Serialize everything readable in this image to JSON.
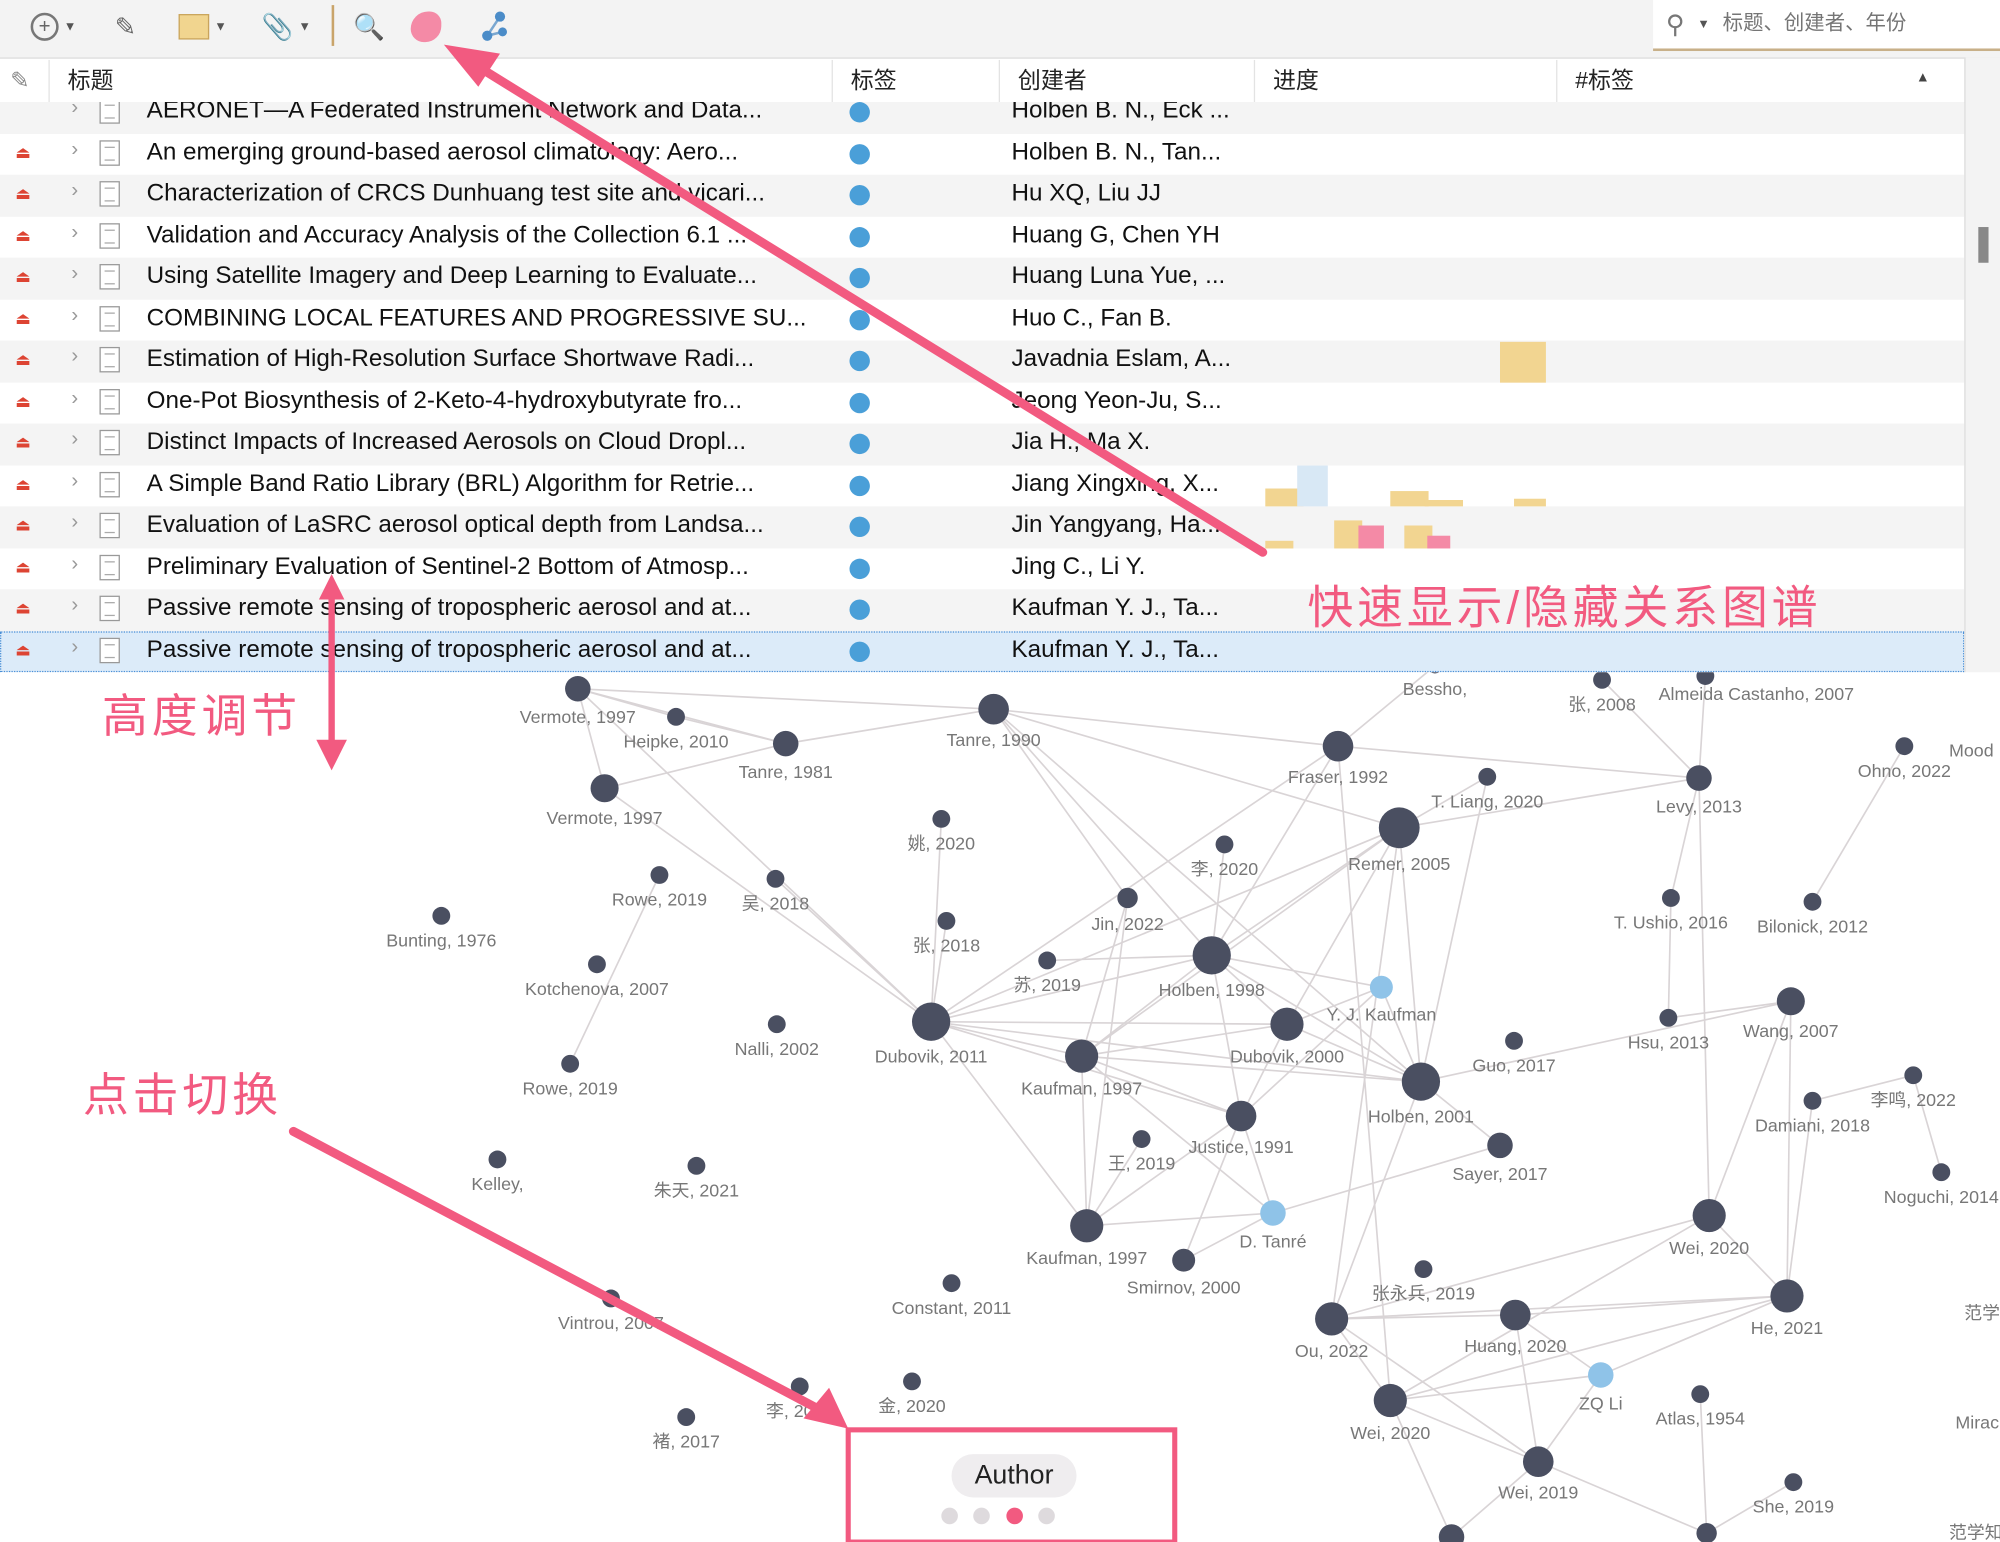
{
  "toolbar": {
    "buttons": [
      "new-item",
      "magic-wand",
      "new-collection",
      "attachment",
      "advanced-search",
      "toggle-graph",
      "graph-view"
    ],
    "search_placeholder": "标题、创建者、年份"
  },
  "table": {
    "columns": {
      "title": "标题",
      "tags": "标签",
      "creator": "创建者",
      "progress": "进度",
      "hashtags": "#标签"
    },
    "tag_color": "#4a9fd8",
    "rows": [
      {
        "title": "AERONET—A Federated Instrument Network and Data...",
        "creator": "Holben B. N., Eck ..."
      },
      {
        "title": "An emerging ground-based aerosol climatology: Aero...",
        "creator": "Holben B. N., Tan..."
      },
      {
        "title": "Characterization of CRCS Dunhuang test site and vicari...",
        "creator": "Hu XQ, Liu JJ"
      },
      {
        "title": "Validation and Accuracy Analysis of the Collection 6.1 ...",
        "creator": "Huang G, Chen YH"
      },
      {
        "title": "Using Satellite Imagery and Deep Learning to Evaluate...",
        "creator": "Huang Luna Yue, ..."
      },
      {
        "title": "COMBINING LOCAL FEATURES AND PROGRESSIVE SU...",
        "creator": "Huo C., Fan B."
      },
      {
        "title": "Estimation of High-Resolution Surface Shortwave Radi...",
        "creator": "Javadnia Eslam, A..."
      },
      {
        "title": "One-Pot Biosynthesis of 2-Keto-4-hydroxybutyrate fro...",
        "creator": "Jeong Yeon-Ju, S..."
      },
      {
        "title": "Distinct Impacts of Increased Aerosols on Cloud Dropl...",
        "creator": "Jia H., Ma X."
      },
      {
        "title": "A Simple Band Ratio Library (BRL) Algorithm for Retrie...",
        "creator": "Jiang Xingxing, X..."
      },
      {
        "title": "Evaluation of LaSRC aerosol optical depth from Landsa...",
        "creator": "Jin Yangyang, Ha..."
      },
      {
        "title": "Preliminary Evaluation of Sentinel-2 Bottom of Atmosp...",
        "creator": "Jing C., Li Y."
      },
      {
        "title": "Passive remote sensing of tropospheric aerosol and at...",
        "creator": "Kaufman Y. J., Ta..."
      },
      {
        "title": "Passive remote sensing of tropospheric aerosol and at...",
        "creator": "Kaufman Y. J., Ta...",
        "selected": true
      }
    ]
  },
  "graph": {
    "node_color": "#4a4f61",
    "highlight_color": "#8fc3e8",
    "edge_color": "#d9d4d6",
    "nodes": [
      "Vermote, 1997",
      "Heipke, 2010",
      "Tanre, 1981",
      "Tanre, 1990",
      "Vermote, 1997",
      "姚, 2020",
      "Rowe, 2019",
      "吴, 2018",
      "Bunting, 1976",
      "张, 2018",
      "Kotchenova, 2007",
      "Nalli, 2002",
      "Dubovik, 2011",
      "Rowe, 2019",
      "Kelley,",
      "朱天, 2021",
      "Vintrou, 2007",
      "Constant, 2011",
      "李, 2020",
      "金, 2020",
      "褚, 2017",
      "Bessho,",
      "张, 2008",
      "Almeida Castanho, 2007",
      "Fraser, 1992",
      "T. Liang, 2020",
      "Levy, 2013",
      "Ohno, 2022",
      "Remer, 2005",
      "李, 2020",
      "Jin, 2022",
      "T. Ushio, 2016",
      "Bilonick, 2012",
      "Holben, 1998",
      "苏, 2019",
      "Y. J. Kaufman",
      "Dubovik, 2000",
      "Wang, 2007",
      "Hsu, 2013",
      "Guo, 2017",
      "Kaufman, 1997",
      "Holben, 2001",
      "李鸣, 2022",
      "Damiani, 2018",
      "Justice, 1991",
      "王, 2019",
      "Sayer, 2017",
      "Noguchi, 2014",
      "D. Tanré",
      "Kaufman, 1997",
      "Smirnov, 2000",
      "Wei, 2020",
      "张永兵, 2019",
      "He, 2021",
      "Ou, 2022",
      "Huang, 2020",
      "ZQ Li",
      "Atlas, 1954",
      "Wei, 2020",
      "Wei, 2019",
      "She, 2019",
      "",
      ""
    ],
    "edge_labels": [
      "Mood",
      "范学",
      "Mirac",
      "范学知"
    ],
    "mode_switch": {
      "label": "Author",
      "pages": 4,
      "active_page": 3
    }
  },
  "annotations": {
    "color": "#f25a80",
    "toggle_graph": "快速显示/隐藏关系图谱",
    "height_adjust": "高度调节",
    "click_switch": "点击切换"
  }
}
